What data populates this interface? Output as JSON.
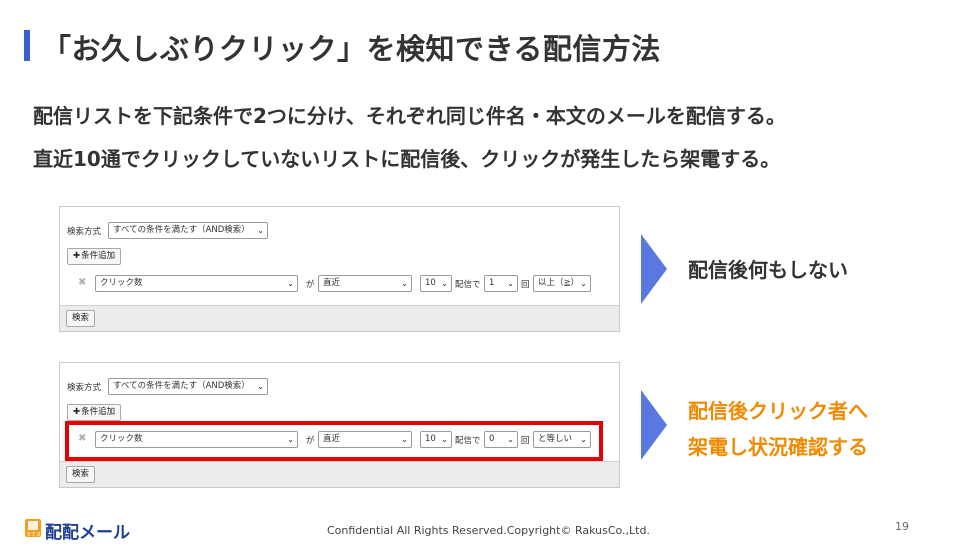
{
  "slide": {
    "title": "「お久しぶりクリック」を検知できる配信方法",
    "intro_line1": "配信リストを下記条件で2つに分け、それぞれ同じ件名・本文のメールを配信する。",
    "intro_line2": "直近10通でクリックしていないリストに配信後、クリックが発生したら架電する。",
    "page_number": "19",
    "footer": "Confidential All Rights Reserved.Copyright© RakusCo.,Ltd.",
    "brand": {
      "mark_small": "ラクス",
      "name": "配配メール"
    },
    "colors": {
      "accent_blue": "#3a63c9",
      "orange": "#f08a00",
      "highlight_red": "#e60000",
      "arrow_blue": "#5a78e0"
    }
  },
  "panel_a": {
    "search_method_label": "検索方式",
    "search_method_value": "すべての条件を満たす（AND検索）",
    "add_condition_label": "条件追加",
    "field_value": "クリック数",
    "ga_label": "が",
    "period_value": "直近",
    "count_value": "10",
    "haishin_de_label": "配信で",
    "times_value": "1",
    "kai_label": "回",
    "comparator_value": "以上（≧）",
    "search_button": "検索"
  },
  "panel_b": {
    "search_method_label": "検索方式",
    "search_method_value": "すべての条件を満たす（AND検索）",
    "add_condition_label": "条件追加",
    "field_value": "クリック数",
    "ga_label": "が",
    "period_value": "直近",
    "count_value": "10",
    "haishin_de_label": "配信で",
    "times_value": "0",
    "kai_label": "回",
    "comparator_value": "と等しい",
    "search_button": "検索"
  },
  "results": {
    "a": "配信後何もしない",
    "b_line1": "配信後クリック者へ",
    "b_line2": "架電し状況確認する"
  }
}
